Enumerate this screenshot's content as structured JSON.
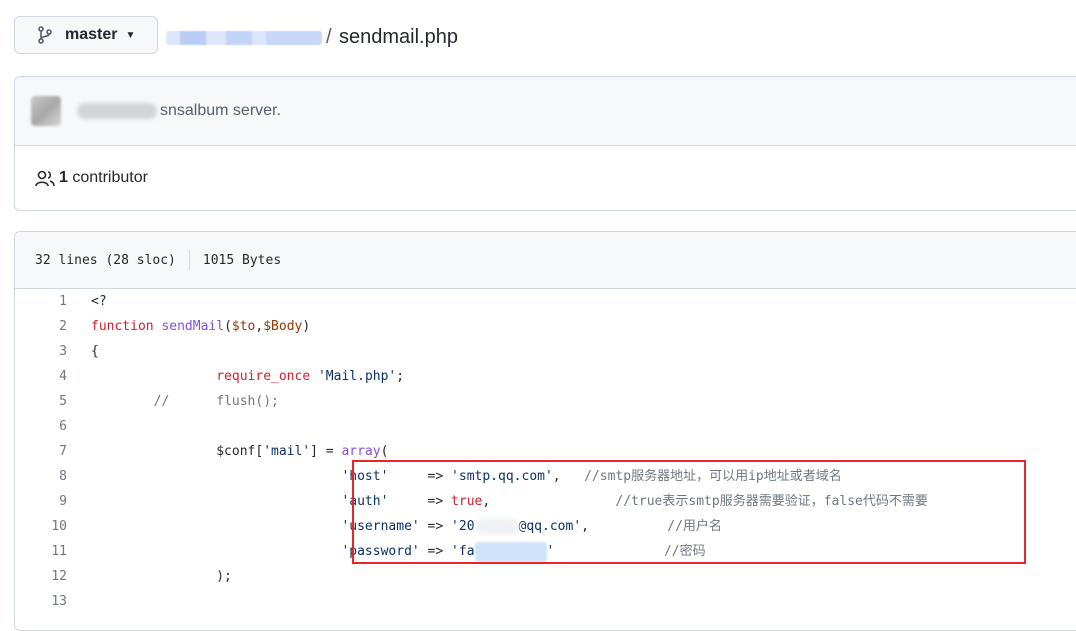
{
  "branch": {
    "label": "master",
    "icon": "git-branch-icon"
  },
  "breadcrumb": {
    "separator": "/",
    "file_name": "sendmail.php"
  },
  "commit": {
    "message": "snsalbum server."
  },
  "contributors": {
    "count": "1",
    "label": "contributor"
  },
  "file_info": {
    "lines": "32 lines (28 sloc)",
    "size": "1015 Bytes"
  },
  "code_lines": [
    {
      "num": "1",
      "text": "<?"
    },
    {
      "num": "2",
      "text": "function sendMail($to,$Body)"
    },
    {
      "num": "3",
      "text": "{"
    },
    {
      "num": "4",
      "text": "require_once 'Mail.php';"
    },
    {
      "num": "5",
      "text": "//      flush();"
    },
    {
      "num": "6",
      "text": ""
    },
    {
      "num": "7",
      "text": "$conf['mail'] = array("
    },
    {
      "num": "8",
      "text": "'host'     => 'smtp.qq.com',   //smtp服务器地址，可以用ip地址或者域名"
    },
    {
      "num": "9",
      "text": "'auth'     => true,                //true表示smtp服务器需要验证，false代码不需要"
    },
    {
      "num": "10",
      "text": "'username' => '20[redacted]@qq.com',          //用户名"
    },
    {
      "num": "11",
      "text": "'password' => 'fa[redacted]'              //密码"
    },
    {
      "num": "12",
      "text": ");"
    },
    {
      "num": "13",
      "text": ""
    }
  ],
  "colors": {
    "highlight_border": "#e5252a",
    "keyword": "#cf222e",
    "function": "#8250df",
    "string": "#0a3069",
    "variable": "#953800"
  }
}
